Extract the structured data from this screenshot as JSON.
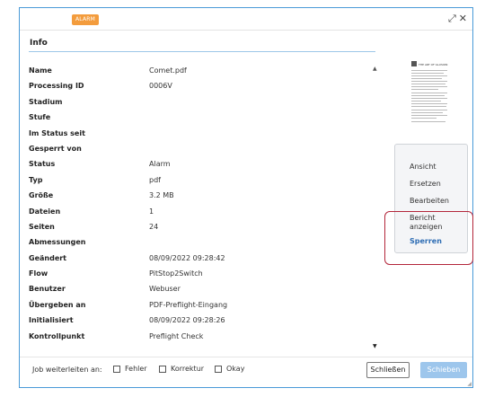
{
  "titlebar": {
    "badge": "ALARM",
    "expand_icon": "expand-icon",
    "close_icon": "close-icon"
  },
  "tab": {
    "label": "Info"
  },
  "properties": [
    {
      "key": "Name",
      "value": "Comet.pdf"
    },
    {
      "key": "Processing ID",
      "value": "0006V"
    },
    {
      "key": "Stadium",
      "value": ""
    },
    {
      "key": "Stufe",
      "value": ""
    },
    {
      "key": "Im Status seit",
      "value": ""
    },
    {
      "key": "Gesperrt von",
      "value": ""
    },
    {
      "key": "Status",
      "value": "Alarm"
    },
    {
      "key": "Typ",
      "value": "pdf"
    },
    {
      "key": "Größe",
      "value": "3.2 MB"
    },
    {
      "key": "Dateien",
      "value": "1"
    },
    {
      "key": "Seiten",
      "value": "24"
    },
    {
      "key": "Abmessungen",
      "value": ""
    },
    {
      "key": "Geändert",
      "value": "08/09/2022 09:28:42"
    },
    {
      "key": "Flow",
      "value": "PitStop2Switch"
    },
    {
      "key": "Benutzer",
      "value": "Webuser"
    },
    {
      "key": "Übergeben an",
      "value": "PDF-Preflight-Eingang"
    },
    {
      "key": "Initialisiert",
      "value": "08/09/2022 09:28:26"
    },
    {
      "key": "Kontrollpunkt",
      "value": "Preflight Check"
    }
  ],
  "thumbnail": {
    "title_text": "THE ART OF ILLUSION"
  },
  "menu": {
    "items": [
      {
        "label": "Ansicht"
      },
      {
        "label": "Ersetzen"
      },
      {
        "label": "Bearbeiten"
      },
      {
        "label_line1": "Bericht",
        "label_line2": "anzeigen"
      },
      {
        "label": "Sperren"
      }
    ]
  },
  "footer": {
    "forward_label": "Job weiterleiten an:",
    "checkboxes": [
      {
        "label": "Fehler",
        "checked": false
      },
      {
        "label": "Korrektur",
        "checked": false
      },
      {
        "label": "Okay",
        "checked": false
      }
    ],
    "close_button": "Schließen",
    "move_button": "Schieben"
  },
  "colors": {
    "accent": "#4a9ad8",
    "badge": "#f39c3d",
    "highlight": "#b3263a",
    "active_link": "#2e6db4",
    "primary_disabled": "#9dc6ec"
  }
}
